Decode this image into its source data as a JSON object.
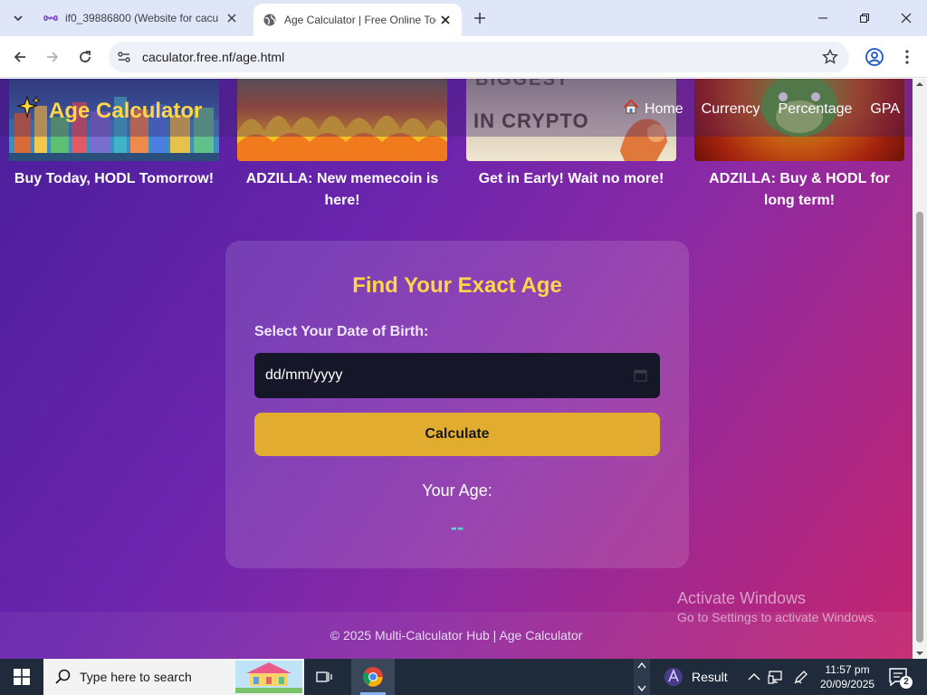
{
  "browser": {
    "tabs": [
      {
        "title": "if0_39886800 (Website for cacu",
        "favicon": "infinity-icon",
        "active": false
      },
      {
        "title": "Age Calculator | Free Online Too",
        "favicon": "globe-icon",
        "active": true
      }
    ],
    "url": "caculator.free.nf/age.html"
  },
  "ads": [
    {
      "caption": "Buy Today, HODL Tomorrow!"
    },
    {
      "caption": "ADZILLA: New memecoin is here!"
    },
    {
      "caption": "Get in Early! Wait no more!",
      "image_text_1": "BIGGEST",
      "image_text_2": "IN CRYPTO"
    },
    {
      "caption": "ADZILLA: Buy & HODL for long term!"
    }
  ],
  "header": {
    "logo_icon": "sparkles-icon",
    "logo_text": "Age Calculator",
    "nav": [
      {
        "label": "Home",
        "icon": "house-icon"
      },
      {
        "label": "Currency"
      },
      {
        "label": "Percentage"
      },
      {
        "label": "GPA"
      }
    ]
  },
  "calculator": {
    "title": "Find Your Exact Age",
    "dob_label": "Select Your Date of Birth:",
    "dob_placeholder": "dd/mm/yyyy",
    "button_label": "Calculate",
    "result_label": "Your Age:",
    "result_value": "--"
  },
  "footer": {
    "text": "© 2025 Multi-Calculator Hub | Age Calculator"
  },
  "watermark": {
    "line1": "Activate Windows",
    "line2": "Go to Settings to activate Windows."
  },
  "taskbar": {
    "search_placeholder": "Type here to search",
    "result_label": "Result",
    "time": "11:57 pm",
    "date": "20/09/2025",
    "notification_count": "2"
  },
  "colors": {
    "accent_yellow": "#ffd54a",
    "button": "#e2ac30",
    "result_cyan": "#5fd4d4",
    "input_bg": "#151728"
  }
}
